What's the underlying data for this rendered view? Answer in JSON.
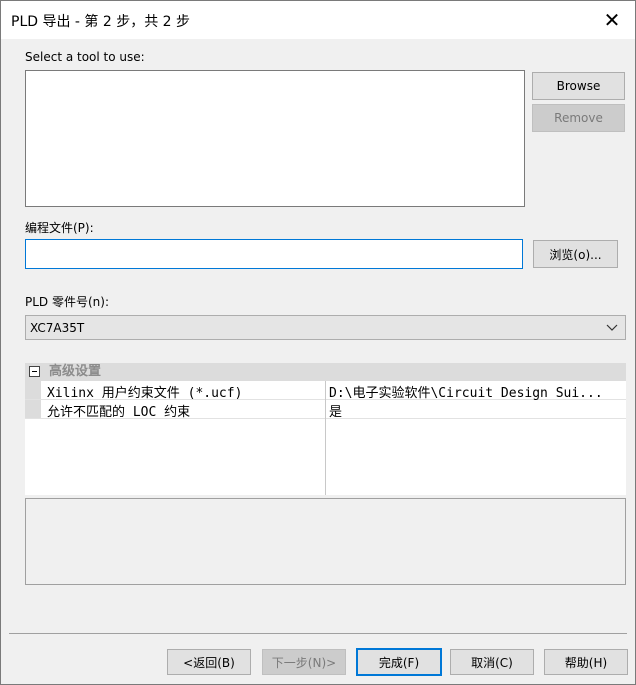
{
  "window": {
    "title": "PLD 导出 - 第 2 步，共 2 步",
    "close_glyph": "✕"
  },
  "tool_section": {
    "label": "Select a tool to use:",
    "items": []
  },
  "side_buttons": {
    "browse": "Browse",
    "remove": "Remove"
  },
  "program_file": {
    "label": "编程文件(P):",
    "value": "",
    "browse_button": "浏览(o)..."
  },
  "part_number": {
    "label": "PLD 零件号(n):",
    "selected": "XC7A35T"
  },
  "advanced": {
    "category": "高级设置",
    "rows": [
      {
        "name": "Xilinx 用户约束文件 (*.ucf)",
        "value": "D:\\电子实验软件\\Circuit Design Sui..."
      },
      {
        "name": "允许不匹配的 LOC 约束",
        "value": "是"
      }
    ]
  },
  "footer": {
    "back": "<返回(B)",
    "next": "下一步(N)>",
    "finish": "完成(F)",
    "cancel": "取消(C)",
    "help": "帮助(H)"
  },
  "colors": {
    "accent": "#0078d7",
    "dialog_bg": "#f0f0f0",
    "disabled_text": "#7a7a7a"
  }
}
